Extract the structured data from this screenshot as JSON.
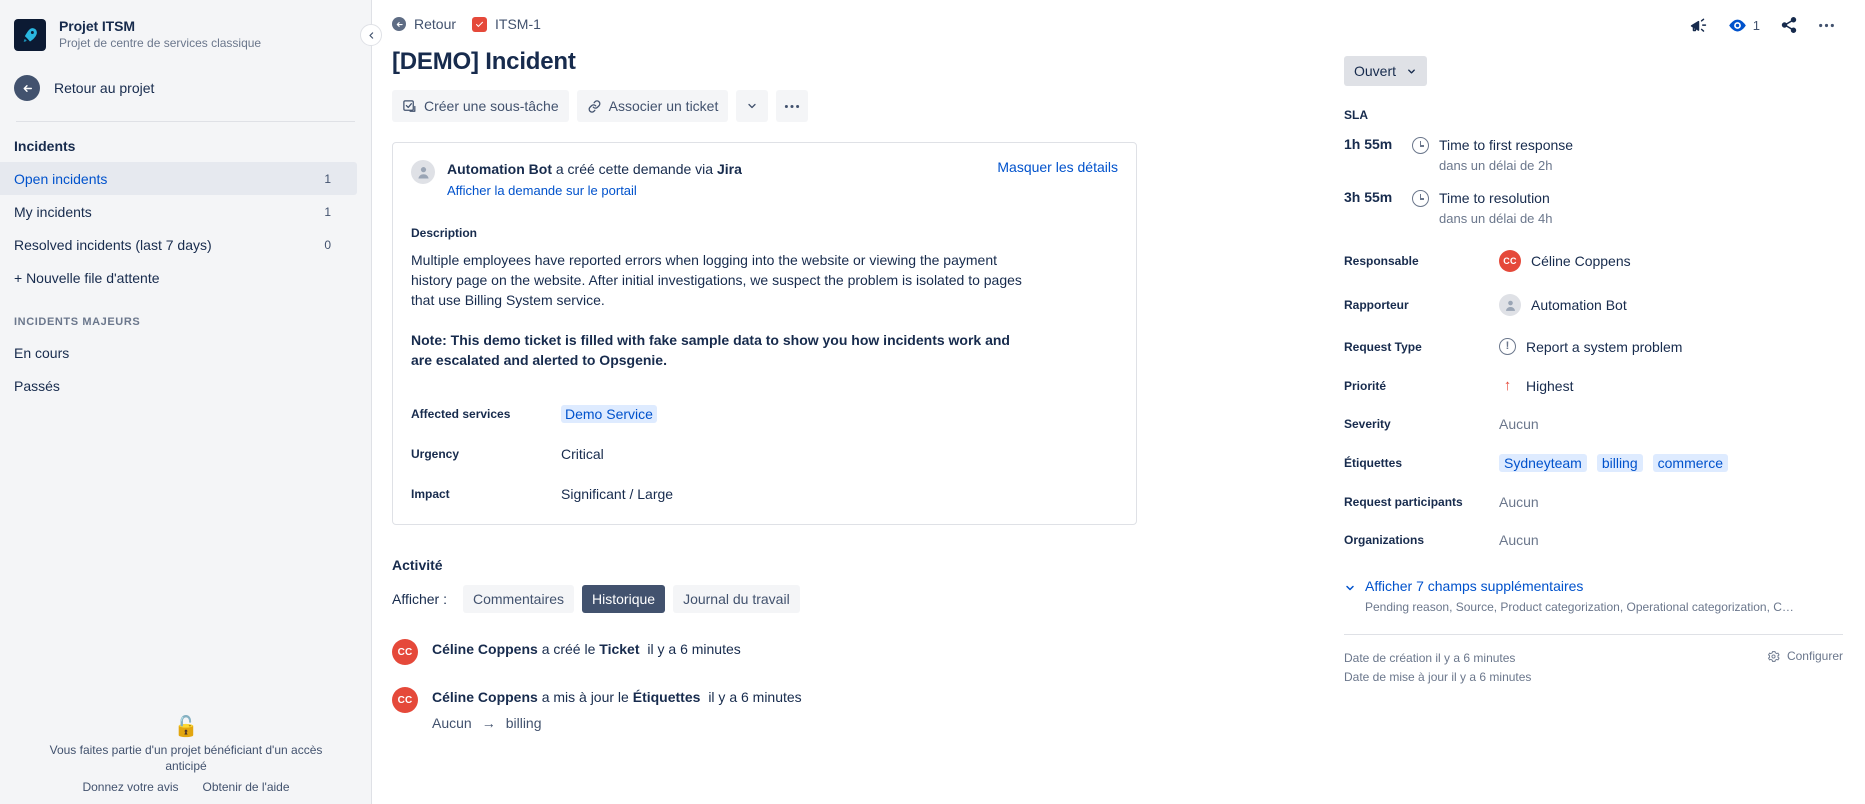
{
  "sidebar": {
    "project_name": "Projet ITSM",
    "project_subtitle": "Projet de centre de services classique",
    "back_label": "Retour au projet",
    "section_title": "Incidents",
    "queues": [
      {
        "label": "Open incidents",
        "count": "1",
        "active": true
      },
      {
        "label": "My incidents",
        "count": "1",
        "active": false
      },
      {
        "label": "Resolved incidents (last 7 days)",
        "count": "0",
        "active": false
      }
    ],
    "new_queue_label": "+ Nouvelle file d'attente",
    "major_caption": "INCIDENTS MAJEURS",
    "major_items": [
      {
        "label": "En cours"
      },
      {
        "label": "Passés"
      }
    ],
    "footer": {
      "lock_icon": "lock-icon",
      "notice": "Vous faites partie d'un projet bénéficiant d'un accès anticipé",
      "feedback_label": "Donnez votre avis",
      "help_label": "Obtenir de l'aide"
    },
    "collapse_icon": "chevron-left-icon"
  },
  "header": {
    "back_label": "Retour",
    "issue_key": "ITSM-1",
    "title": "[DEMO] Incident",
    "toolbar": {
      "create_subtask": "Créer une sous-tâche",
      "link_issue": "Associer un ticket",
      "more_dropdown_icon": "chevron-down-icon",
      "more_actions_icon": "ellipsis-icon"
    }
  },
  "card": {
    "creator_name": "Automation Bot",
    "creator_text": "a créé cette demande via",
    "creator_source": "Jira",
    "portal_link": "Afficher la demande sur le portail",
    "hide_details": "Masquer les détails",
    "description_label": "Description",
    "description_body": "Multiple employees have reported errors when logging into the website or viewing the payment history page on the website. After initial investigations, we suspect the problem is isolated to pages that use Billing System service.",
    "description_note": "Note: This demo ticket is filled with fake sample data to show you how incidents work and are escalated and alerted to Opsgenie.",
    "fields": [
      {
        "label": "Affected services",
        "value": "Demo Service",
        "type": "link"
      },
      {
        "label": "Urgency",
        "value": "Critical",
        "type": "text"
      },
      {
        "label": "Impact",
        "value": "Significant / Large",
        "type": "text"
      }
    ]
  },
  "activity": {
    "title": "Activité",
    "show_label": "Afficher :",
    "tabs": [
      {
        "label": "Commentaires",
        "selected": false
      },
      {
        "label": "Historique",
        "selected": true
      },
      {
        "label": "Journal du travail",
        "selected": false
      }
    ],
    "entries": [
      {
        "initials": "CC",
        "author": "Céline Coppens",
        "action_pre": "a créé le",
        "action_target": "Ticket",
        "time": "il y a 6 minutes",
        "from": "",
        "to": ""
      },
      {
        "initials": "CC",
        "author": "Céline Coppens",
        "action_pre": "a mis à jour le",
        "action_target": "Étiquettes",
        "time": "il y a 6 minutes",
        "from": "Aucun",
        "to": "billing"
      }
    ]
  },
  "right": {
    "icons": {
      "announce": "megaphone-icon",
      "watch": "eye-icon",
      "watch_count": "1",
      "share": "share-icon",
      "more": "ellipsis-icon"
    },
    "status_label": "Ouvert",
    "status_chevron": "chevron-down-icon",
    "sla_label": "SLA",
    "sla": [
      {
        "time": "1h 55m",
        "name": "Time to first response",
        "sub": "dans un délai de 2h"
      },
      {
        "time": "3h 55m",
        "name": "Time to resolution",
        "sub": "dans un délai de 4h"
      }
    ],
    "fields": {
      "assignee_label": "Responsable",
      "assignee_value": "Céline Coppens",
      "assignee_initials": "CC",
      "reporter_label": "Rapporteur",
      "reporter_value": "Automation Bot",
      "request_type_label": "Request Type",
      "request_type_value": "Report a system problem",
      "priority_label": "Priorité",
      "priority_value": "Highest",
      "severity_label": "Severity",
      "severity_value": "Aucun",
      "labels_label": "Étiquettes",
      "labels_values": [
        "Sydneyteam",
        "billing",
        "commerce"
      ],
      "participants_label": "Request participants",
      "participants_value": "Aucun",
      "organizations_label": "Organizations",
      "organizations_value": "Aucun"
    },
    "more_fields_link": "Afficher 7 champs supplémentaires",
    "more_fields_sub": "Pending reason, Source, Product categorization, Operational categorization, Compos...",
    "created_date": "Date de création il y a 6 minutes",
    "updated_date": "Date de mise à jour il y a 6 minutes",
    "configure_label": "Configurer"
  },
  "colors": {
    "accent": "#0052cc",
    "red": "#e5493a",
    "bg_grey": "#f4f5f7",
    "border": "#dfe1e6",
    "text": "#172b4d",
    "subtle": "#6b778c"
  }
}
